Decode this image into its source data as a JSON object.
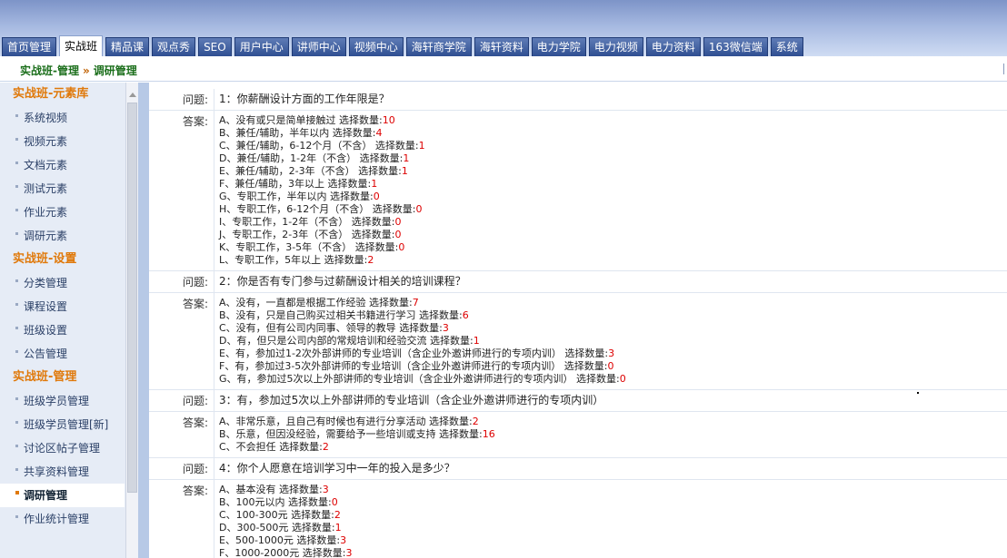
{
  "tabs": [
    {
      "label": "首页管理",
      "active": false
    },
    {
      "label": "实战班",
      "active": true
    },
    {
      "label": "精品课",
      "active": false
    },
    {
      "label": "观点秀",
      "active": false
    },
    {
      "label": "SEO",
      "active": false
    },
    {
      "label": "用户中心",
      "active": false
    },
    {
      "label": "讲师中心",
      "active": false
    },
    {
      "label": "视频中心",
      "active": false
    },
    {
      "label": "海轩商学院",
      "active": false
    },
    {
      "label": "海轩资料",
      "active": false
    },
    {
      "label": "电力学院",
      "active": false
    },
    {
      "label": "电力视频",
      "active": false
    },
    {
      "label": "电力资料",
      "active": false
    },
    {
      "label": "163微信端",
      "active": false
    },
    {
      "label": "系统",
      "active": false
    }
  ],
  "breadcrumb": {
    "part1": "实战班-管理",
    "sep": "»",
    "part2": "调研管理"
  },
  "sidebar": [
    {
      "title": "实战班-元素库",
      "items": [
        "系统视频",
        "视频元素",
        "文档元素",
        "测试元素",
        "作业元素",
        "调研元素"
      ]
    },
    {
      "title": "实战班-设置",
      "items": [
        "分类管理",
        "课程设置",
        "班级设置",
        "公告管理"
      ]
    },
    {
      "title": "实战班-管理",
      "items": [
        "班级学员管理",
        "班级学员管理[新]",
        "讨论区帖子管理",
        "共享资料管理",
        "调研管理",
        "作业统计管理"
      ]
    }
  ],
  "active_sidebar_item": "调研管理",
  "labels": {
    "question": "问题:",
    "answer": "答案:",
    "count": "选择数量:"
  },
  "questions": [
    {
      "text": "1：你薪酬设计方面的工作年限是？",
      "options": [
        {
          "text": "A、没有或只是简单接触过",
          "count": "10"
        },
        {
          "text": "B、兼任/辅助，半年以内",
          "count": "4"
        },
        {
          "text": "C、兼任/辅助，6-12个月（不含）",
          "count": "1"
        },
        {
          "text": "D、兼任/辅助，1-2年（不含）",
          "count": "1"
        },
        {
          "text": "E、兼任/辅助，2-3年（不含）",
          "count": "1"
        },
        {
          "text": "F、兼任/辅助，3年以上",
          "count": "1"
        },
        {
          "text": "G、专职工作，半年以内",
          "count": "0"
        },
        {
          "text": "H、专职工作，6-12个月（不含）",
          "count": "0"
        },
        {
          "text": "I、专职工作，1-2年（不含）",
          "count": "0"
        },
        {
          "text": "J、专职工作，2-3年（不含）",
          "count": "0"
        },
        {
          "text": "K、专职工作，3-5年（不含）",
          "count": "0"
        },
        {
          "text": "L、专职工作，5年以上",
          "count": "2"
        }
      ]
    },
    {
      "text": "2：你是否有专门参与过薪酬设计相关的培训课程？",
      "options": [
        {
          "text": "A、没有，一直都是根据工作经验",
          "count": "7"
        },
        {
          "text": "B、没有，只是自己购买过相关书籍进行学习",
          "count": "6"
        },
        {
          "text": "C、没有，但有公司内同事、领导的教导",
          "count": "3"
        },
        {
          "text": "D、有，但只是公司内部的常规培训和经验交流",
          "count": "1"
        },
        {
          "text": "E、有，参加过1-2次外部讲师的专业培训（含企业外邀讲师进行的专项内训）",
          "count": "3"
        },
        {
          "text": "F、有，参加过3-5次外部讲师的专业培训（含企业外邀讲师进行的专项内训）",
          "count": "0"
        },
        {
          "text": "G、有，参加过5次以上外部讲师的专业培训（含企业外邀讲师进行的专项内训）",
          "count": "0"
        }
      ]
    },
    {
      "text": "3：有，参加过5次以上外部讲师的专业培训（含企业外邀讲师进行的专项内训）",
      "options": [
        {
          "text": "A、非常乐意，且自己有时候也有进行分享活动",
          "count": "2"
        },
        {
          "text": "B、乐意，但因没经验，需要给予一些培训或支持",
          "count": "16"
        },
        {
          "text": "C、不会担任",
          "count": "2"
        }
      ]
    },
    {
      "text": "4：你个人愿意在培训学习中一年的投入是多少？",
      "options": [
        {
          "text": "A、基本没有",
          "count": "3"
        },
        {
          "text": "B、100元以内",
          "count": "0"
        },
        {
          "text": "C、100-300元",
          "count": "2"
        },
        {
          "text": "D、300-500元",
          "count": "1"
        },
        {
          "text": "E、500-1000元",
          "count": "3"
        },
        {
          "text": "F、1000-2000元",
          "count": "3"
        }
      ]
    }
  ]
}
